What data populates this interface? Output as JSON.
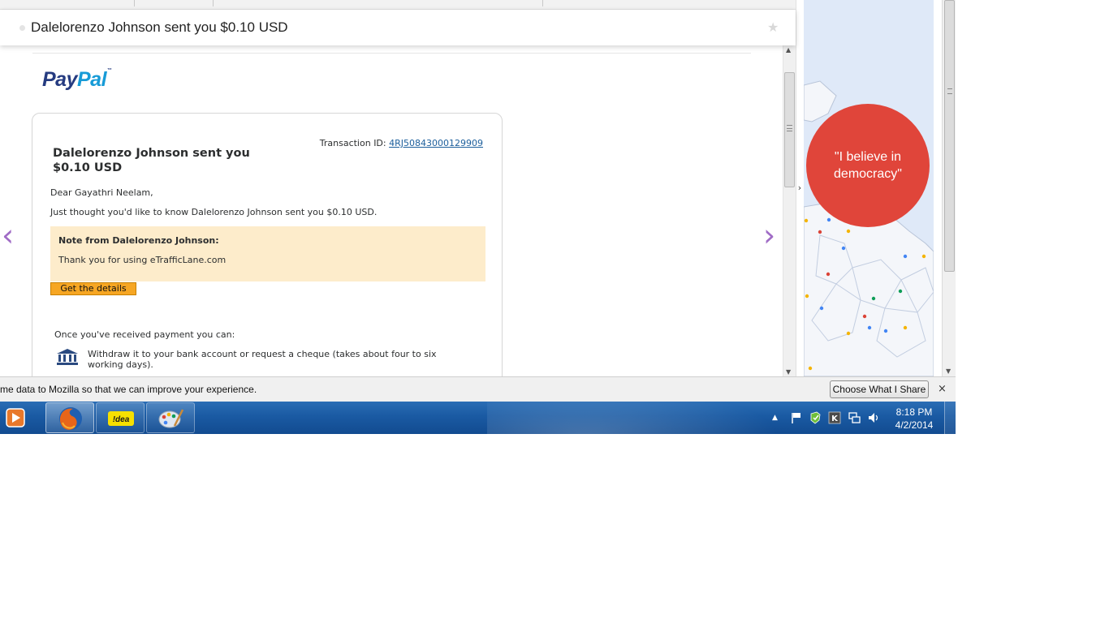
{
  "subject": {
    "title": "Dalelorenzo Johnson sent you $0.10 USD",
    "star_icon": "star-icon"
  },
  "email": {
    "logo": {
      "pay": "Pay",
      "pal": "Pal",
      "tm": "™"
    },
    "headline": "Dalelorenzo Johnson sent you $0.10 USD",
    "transaction_label": "Transaction ID:",
    "transaction_id": "4RJ50843000129909",
    "greeting": "Dear Gayathri Neelam,",
    "intro": "Just thought you'd like to know Dalelorenzo Johnson sent you $0.10 USD.",
    "note": {
      "title": "Note from Dalelorenzo Johnson:",
      "text": "Thank you for using eTrafficLane.com"
    },
    "details_button": "Get the details",
    "once_received": "Once you've received payment you can:",
    "withdraw": "Withdraw it to your bank account or request a cheque (takes about four to six working days).",
    "nav_prev": "‹",
    "nav_next": "›"
  },
  "side_panel": {
    "chevron": "›",
    "quote": "\"I believe in democracy\"",
    "colors": {
      "circle": "#e0453a",
      "map_bg": "#dfe9f8"
    }
  },
  "notification": {
    "text": "me data to Mozilla so that we can improve your experience.",
    "button": "Choose What I Share",
    "close": "×"
  },
  "taskbar": {
    "apps": [
      {
        "name": "media-player",
        "icon": "media-player-icon"
      },
      {
        "name": "firefox",
        "icon": "firefox-icon",
        "active": true
      },
      {
        "name": "idea",
        "icon": "idea-icon",
        "label": "!dea"
      },
      {
        "name": "paint",
        "icon": "paint-icon"
      }
    ],
    "tray_icons": [
      "show-hidden-icon",
      "action-center-flag-icon",
      "security-shield-icon",
      "app-k-icon",
      "network-icon",
      "volume-icon"
    ],
    "time": "8:18 PM",
    "date": "4/2/2014"
  }
}
